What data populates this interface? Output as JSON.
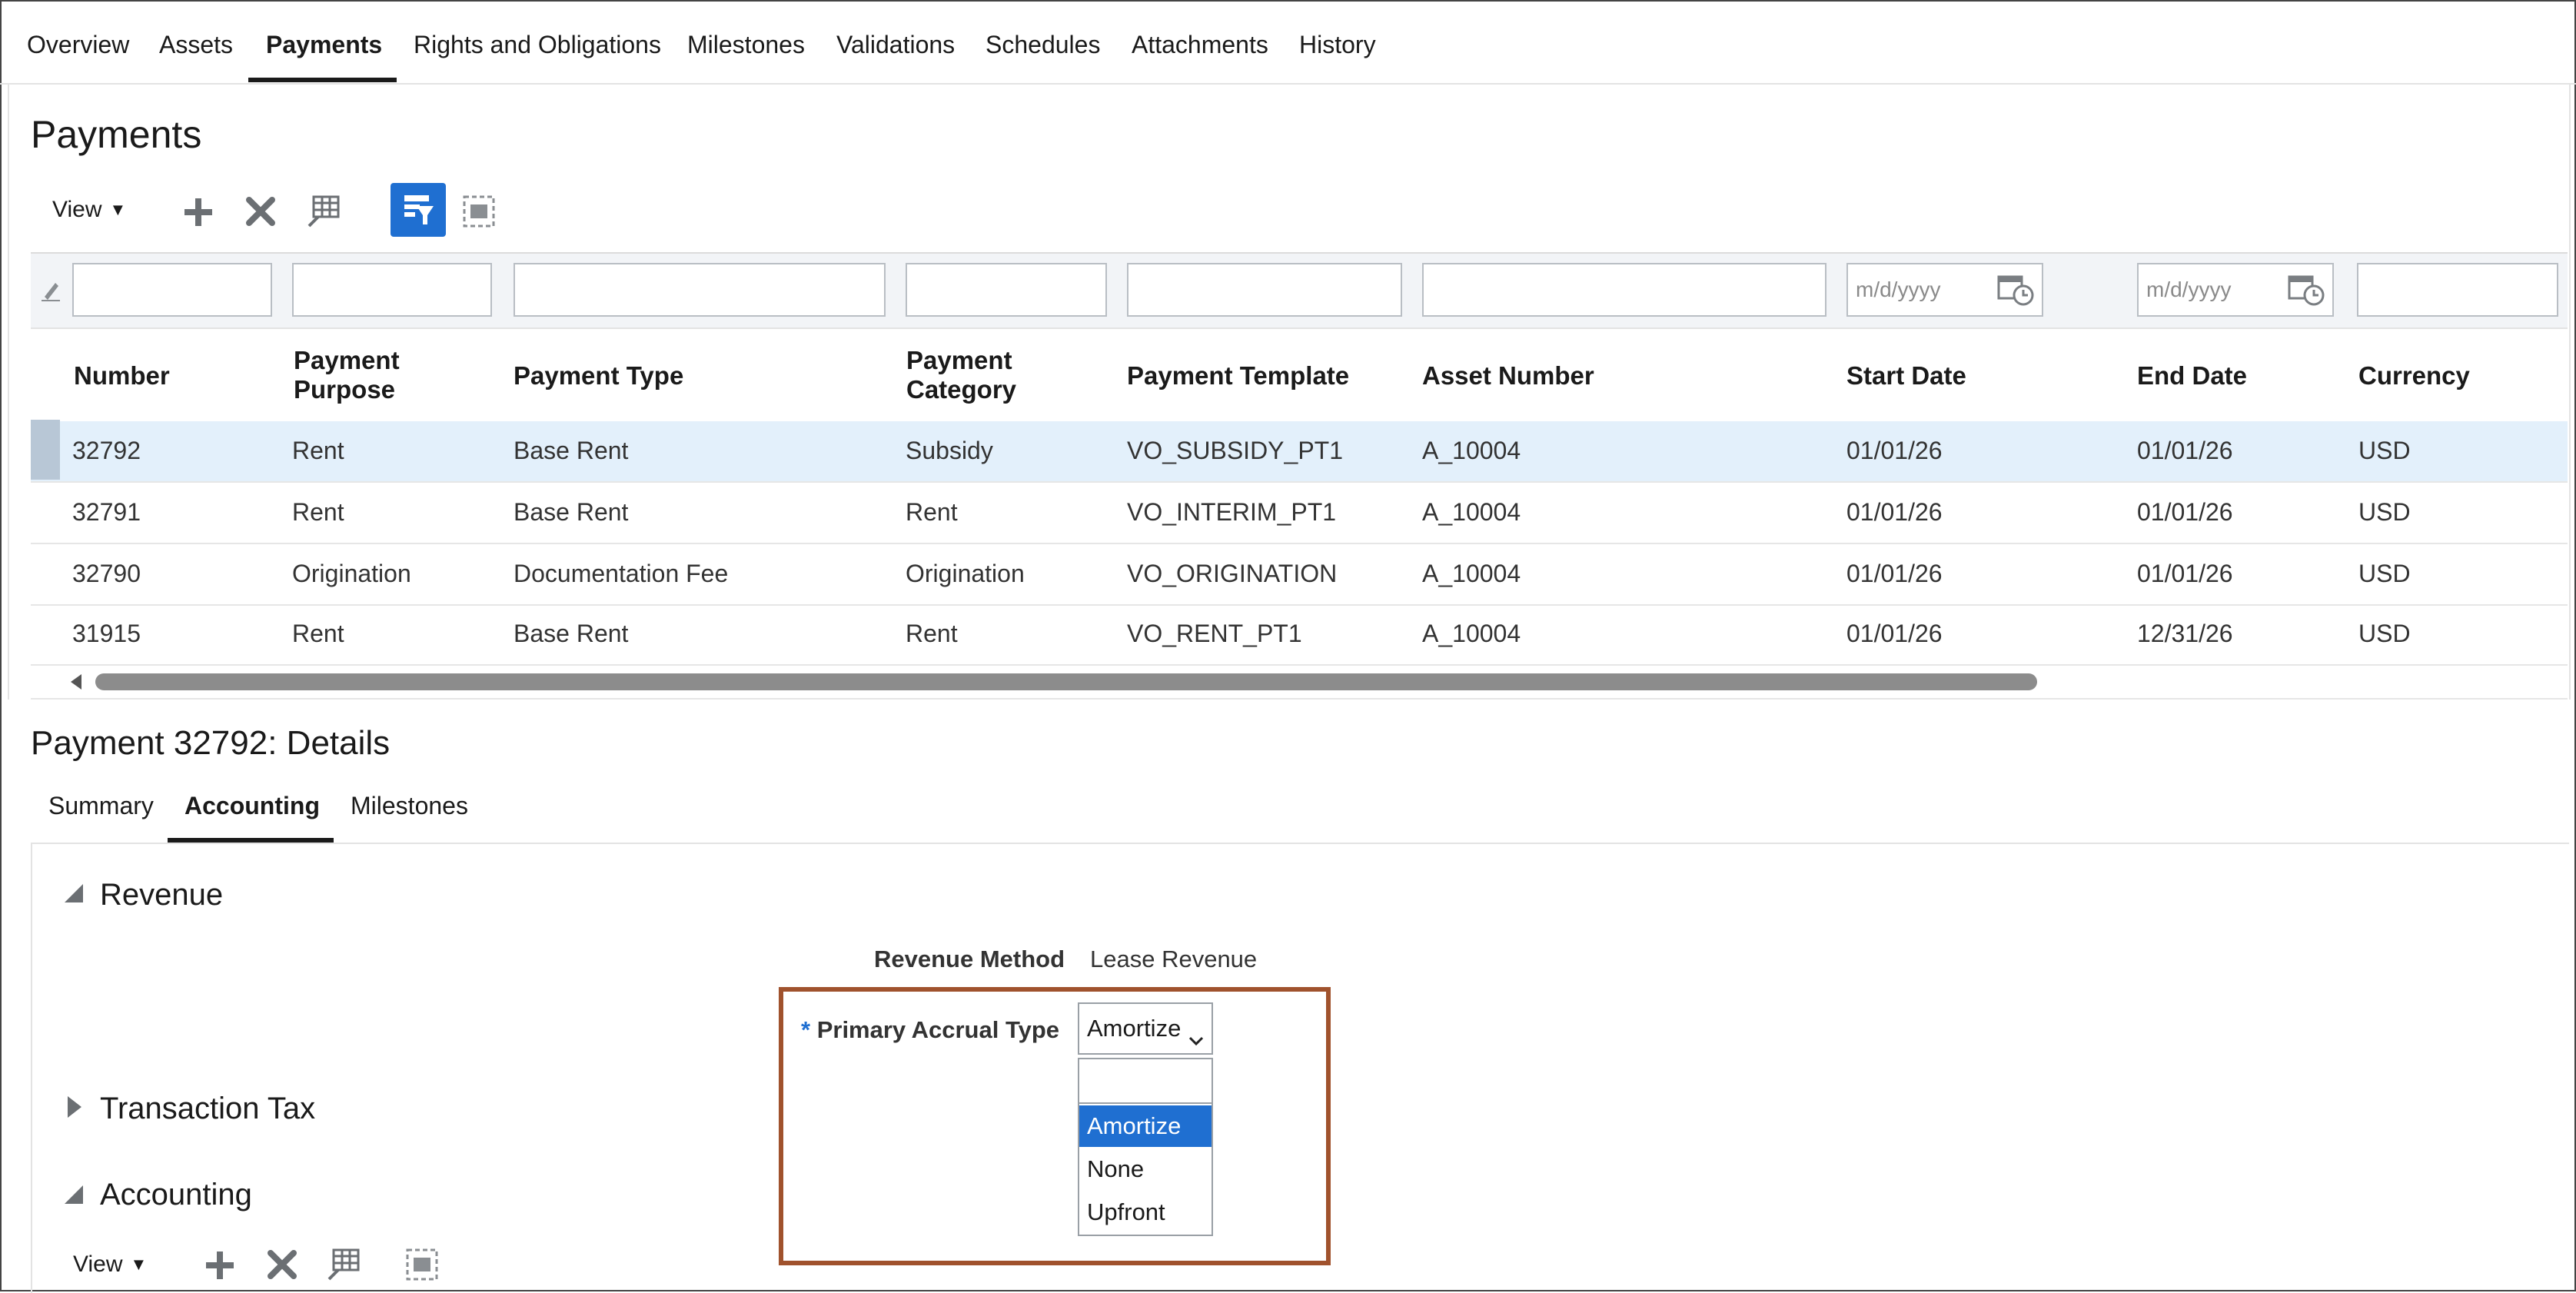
{
  "top_tabs": [
    "Overview",
    "Assets",
    "Payments",
    "Rights and Obligations",
    "Milestones",
    "Validations",
    "Schedules",
    "Attachments",
    "History"
  ],
  "active_top_tab": "Payments",
  "payments": {
    "title": "Payments",
    "toolbar": {
      "view_label": "View"
    },
    "filters": {
      "date_placeholder": "m/d/yyyy"
    },
    "columns": [
      "Number",
      "Payment Purpose",
      "Payment Type",
      "Payment Category",
      "Payment Template",
      "Asset Number",
      "Start Date",
      "End Date",
      "Currency"
    ],
    "header_lines": [
      [
        "Number"
      ],
      [
        "Payment",
        "Purpose"
      ],
      [
        "Payment Type"
      ],
      [
        "Payment",
        "Category"
      ],
      [
        "Payment Template"
      ],
      [
        "Asset Number"
      ],
      [
        "Start Date"
      ],
      [
        "End Date"
      ],
      [
        "Currency"
      ]
    ],
    "rows": [
      [
        "32792",
        "Rent",
        "Base Rent",
        "Subsidy",
        "VO_SUBSIDY_PT1",
        "A_10004",
        "01/01/26",
        "01/01/26",
        "USD"
      ],
      [
        "32791",
        "Rent",
        "Base Rent",
        "Rent",
        "VO_INTERIM_PT1",
        "A_10004",
        "01/01/26",
        "01/01/26",
        "USD"
      ],
      [
        "32790",
        "Origination",
        "Documentation Fee",
        "Origination",
        "VO_ORIGINATION",
        "A_10004",
        "01/01/26",
        "01/01/26",
        "USD"
      ],
      [
        "31915",
        "Rent",
        "Base Rent",
        "Rent",
        "VO_RENT_PT1",
        "A_10004",
        "01/01/26",
        "12/31/26",
        "USD"
      ]
    ],
    "selected_row": 0
  },
  "details": {
    "title": "Payment 32792: Details",
    "tabs": [
      "Summary",
      "Accounting",
      "Milestones"
    ],
    "active_tab": "Accounting",
    "sections": {
      "revenue": "Revenue",
      "transaction_tax": "Transaction Tax",
      "accounting": "Accounting"
    },
    "revenue_method_label": "Revenue Method",
    "revenue_method_value": "Lease Revenue",
    "required_marker": "*",
    "primary_accrual_label": "Primary Accrual Type",
    "primary_accrual_value": "Amortize",
    "primary_accrual_options": [
      "",
      "Amortize",
      "None",
      "Upfront"
    ],
    "highlighted_option": "Amortize",
    "accounting_toolbar": {
      "view_label": "View"
    }
  },
  "colors": {
    "accent": "#1f6fd1",
    "selected_row": "#e3f0fb",
    "callout_border": "#a0522d"
  }
}
